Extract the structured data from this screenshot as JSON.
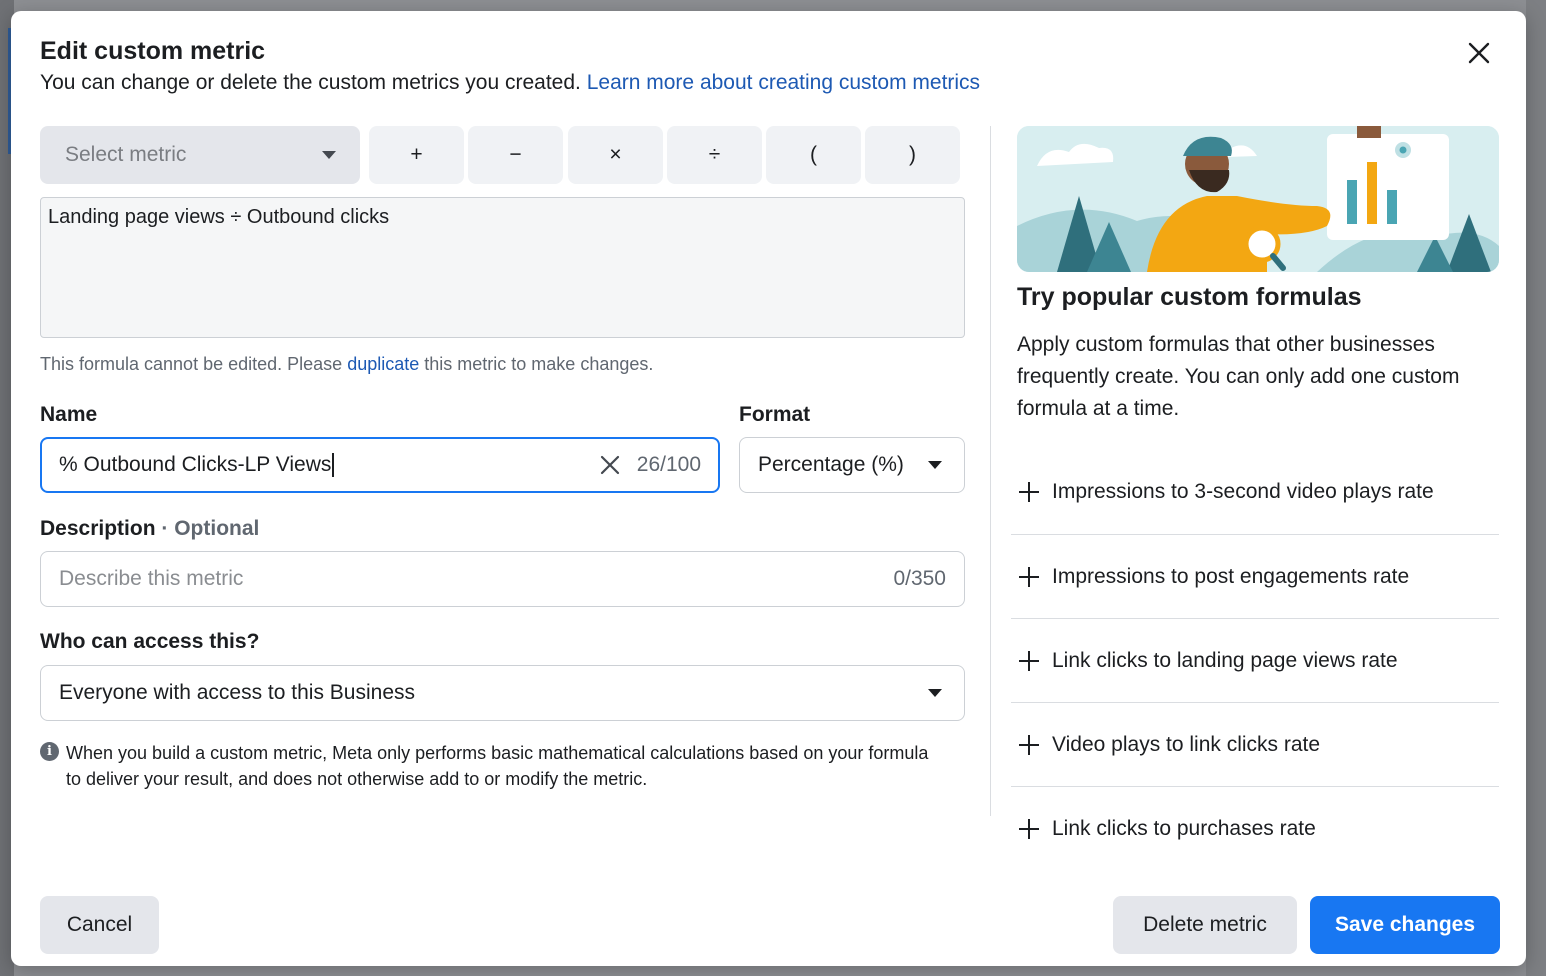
{
  "modal": {
    "title": "Edit custom metric",
    "subtitle": "You can change or delete the custom metrics you created.",
    "learn_more_link": "Learn more about creating custom metrics"
  },
  "formula_builder": {
    "select_metric_placeholder": "Select metric",
    "operators": [
      "+",
      "−",
      "×",
      "÷",
      "(",
      ")"
    ],
    "formula": "Landing page views ÷ Outbound clicks",
    "note_prefix": "This formula cannot be edited. Please",
    "note_link": "duplicate",
    "note_suffix": "this metric to make changes."
  },
  "name_field": {
    "label": "Name",
    "value": "% Outbound Clicks-LP Views",
    "char_count": "26/100"
  },
  "format_field": {
    "label": "Format",
    "value": "Percentage (%)"
  },
  "description_field": {
    "label": "Description",
    "optional_label": "· Optional",
    "placeholder": "Describe this metric",
    "char_count": "0/350"
  },
  "access_field": {
    "label": "Who can access this?",
    "value": "Everyone with access to this Business"
  },
  "disclaimer": "When you build a custom metric, Meta only performs basic mathematical calculations based on your formula to deliver your result, and does not otherwise add to or modify the metric.",
  "popular_formulas": {
    "title": "Try popular custom formulas",
    "description": "Apply custom formulas that other businesses frequently create. You can only add one custom formula at a time.",
    "items": [
      "Impressions to 3-second video plays rate",
      "Impressions to post engagements rate",
      "Link clicks to landing page views rate",
      "Video plays to link clicks rate",
      "Link clicks to purchases rate"
    ]
  },
  "footer": {
    "cancel_label": "Cancel",
    "delete_label": "Delete metric",
    "save_label": "Save changes"
  },
  "colors": {
    "primary": "#1877f2",
    "link": "#1d59b3",
    "button_secondary": "#e4e6eb"
  },
  "icons": {
    "close": "close-icon",
    "clear": "clear-icon",
    "dropdown": "caret-down-icon",
    "info": "info-icon",
    "add": "plus-icon"
  }
}
